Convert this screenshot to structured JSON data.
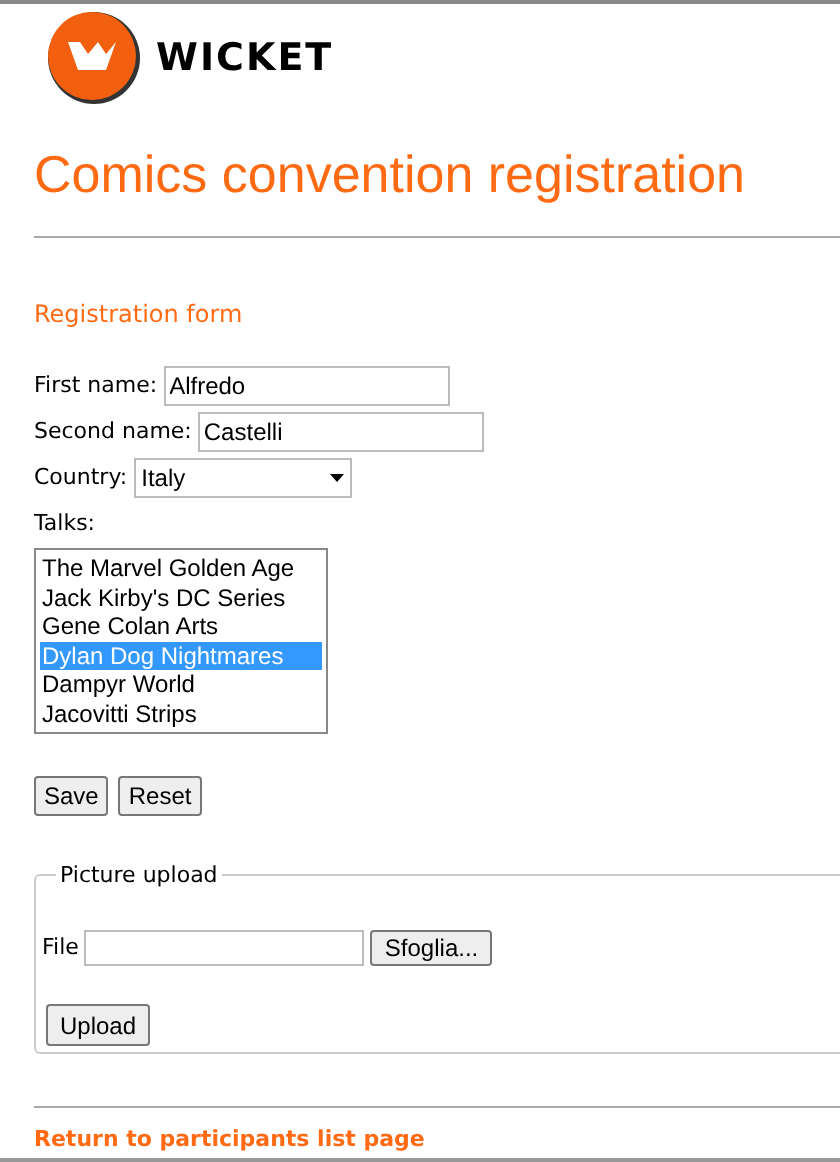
{
  "logo": {
    "text": "WICKET"
  },
  "title": "Comics convention registration",
  "form": {
    "heading": "Registration form",
    "fields": [
      {
        "kind": "text",
        "label": "First name:",
        "value": "Alfredo"
      },
      {
        "kind": "text",
        "label": "Second name:",
        "value": "Castelli"
      },
      {
        "kind": "select",
        "label": "Country:",
        "value": "Italy"
      }
    ],
    "talks": {
      "label": "Talks:",
      "options": [
        {
          "label": "The Marvel Golden Age",
          "selected": false
        },
        {
          "label": "Jack Kirby's DC Series",
          "selected": false
        },
        {
          "label": "Gene Colan Arts",
          "selected": false
        },
        {
          "label": "Dylan Dog Nightmares",
          "selected": true
        },
        {
          "label": "Dampyr World",
          "selected": false
        },
        {
          "label": "Jacovitti Strips",
          "selected": false
        }
      ]
    },
    "buttons": [
      "Save",
      "Reset"
    ]
  },
  "upload": {
    "legend": "Picture upload",
    "file_label": "File",
    "browse_button": "Sfoglia...",
    "button": "Upload"
  },
  "link": "Return to participants list page"
}
